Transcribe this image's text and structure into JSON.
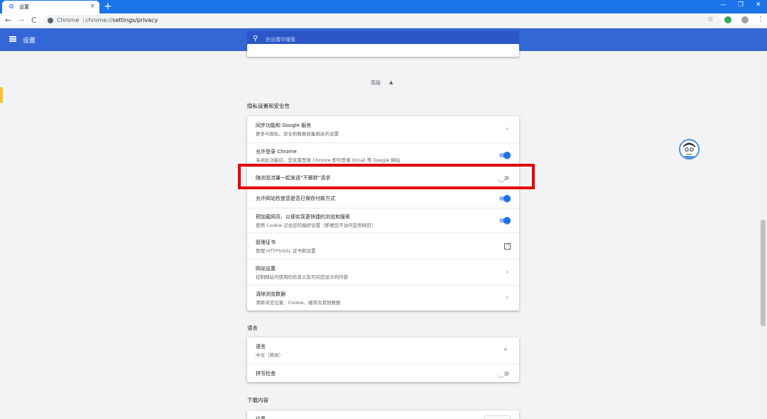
{
  "browser": {
    "tab_title": "设置",
    "tab_close": "×",
    "new_tab": "+",
    "window_controls": [
      "—",
      "❐",
      "✕"
    ],
    "nav": {
      "back": "←",
      "forward": "→",
      "reload": "C"
    },
    "omnibox_label": "Chrome",
    "omnibox_separator": "|",
    "url_scheme": "chrome://",
    "url_path": "settings/privacy",
    "right_icons": [
      "star-icon",
      "extension-icon",
      "profile-icon",
      "more-icon"
    ],
    "star": "☆",
    "more": "⋮"
  },
  "header": {
    "title": "设置",
    "search_placeholder": "在设置中搜索"
  },
  "advanced": {
    "label": "高级",
    "arrow": "▲"
  },
  "privacy": {
    "section_title": "隐私设置和安全性",
    "rows": [
      {
        "label": "同步功能和 Google 服务",
        "sub": "更多与隐私、安全和数据收集相关的设置",
        "control": "arrow"
      },
      {
        "label": "允许登录 Chrome",
        "sub": "关闭此功能后，您无需登录 Chrome 即可登录 Gmail 等 Google 网站",
        "control": "toggle",
        "on": true
      },
      {
        "label": "随浏览流量一起发送“不跟踪”请求",
        "sub": "",
        "control": "toggle",
        "on": false
      },
      {
        "label": "允许网站检查您是否已保存付款方式",
        "sub": "",
        "control": "toggle",
        "on": true
      },
      {
        "label": "预加载网页，以便实现更快捷的浏览和搜索",
        "sub": "使用 Cookie 记住您的偏好设置（即便您不访问这些网页）",
        "control": "toggle",
        "on": true
      },
      {
        "label": "管理证书",
        "sub": "管理 HTTPS/SSL 证书和设置",
        "control": "external"
      },
      {
        "label": "网站设置",
        "sub": "控制网站可使用的信息以及可向您显示的内容",
        "control": "arrow"
      },
      {
        "label": "清除浏览数据",
        "sub": "清除浏览记录、Cookie、缓存及其他数据",
        "control": "arrow"
      }
    ]
  },
  "languages": {
    "section_title": "语言",
    "rows": [
      {
        "label": "语言",
        "sub": "中文（简体）",
        "control": "chevron"
      },
      {
        "label": "拼写检查",
        "sub": "",
        "control": "toggle",
        "on": false
      }
    ]
  },
  "downloads": {
    "section_title": "下载内容",
    "rows": [
      {
        "label": "位置"
      }
    ]
  },
  "glyphs": {
    "arrow": "›",
    "chevron": "⌄",
    "search": "⚲",
    "gear": "⚙"
  },
  "colors": {
    "accent": "#1a73e8",
    "header": "#3367d6",
    "highlight": "#e60000"
  }
}
